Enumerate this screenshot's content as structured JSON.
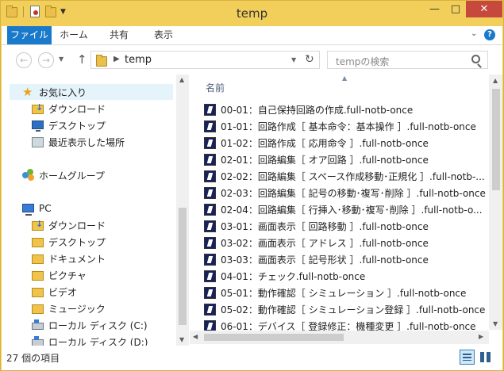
{
  "window": {
    "title": "temp"
  },
  "ribbon": {
    "tabs": [
      "ファイル",
      "ホーム",
      "共有",
      "表示"
    ],
    "help_symbol": "?"
  },
  "navigation": {
    "path": "temp",
    "search_placeholder": "tempの検索"
  },
  "sidebar": {
    "items": [
      {
        "label": "お気に入り",
        "icon": "star-icon",
        "indent": 0
      },
      {
        "label": "ダウンロード",
        "icon": "downloads-folder-icon",
        "indent": 1
      },
      {
        "label": "デスクトップ",
        "icon": "desktop-icon",
        "indent": 1
      },
      {
        "label": "最近表示した場所",
        "icon": "recent-places-icon",
        "indent": 1
      },
      {
        "label": "ホームグループ",
        "icon": "homegroup-icon",
        "indent": 0
      },
      {
        "label": "PC",
        "icon": "pc-icon",
        "indent": 0
      },
      {
        "label": "ダウンロード",
        "icon": "downloads-folder-icon",
        "indent": 1
      },
      {
        "label": "デスクトップ",
        "icon": "desktop-folder-icon",
        "indent": 1
      },
      {
        "label": "ドキュメント",
        "icon": "documents-folder-icon",
        "indent": 1
      },
      {
        "label": "ピクチャ",
        "icon": "pictures-folder-icon",
        "indent": 1
      },
      {
        "label": "ビデオ",
        "icon": "videos-folder-icon",
        "indent": 1
      },
      {
        "label": "ミュージック",
        "icon": "music-folder-icon",
        "indent": 1
      },
      {
        "label": "ローカル ディスク (C:)",
        "icon": "drive-icon",
        "indent": 1
      },
      {
        "label": "ローカル ディスク (D:)",
        "icon": "drive-icon",
        "indent": 1
      }
    ]
  },
  "filelist": {
    "column_name": "名前",
    "files": [
      "00-01：自己保持回路の作成.full-notb-once",
      "01-01：回路作成［ 基本命令：基本操作 ］.full-notb-once",
      "01-02：回路作成［ 応用命令 ］.full-notb-once",
      "02-01：回路編集［ オア回路 ］.full-notb-once",
      "02-02：回路編集［ スペース作成移動･正規化 ］.full-notb-...",
      "02-03：回路編集［ 記号の移動･複写･削除 ］.full-notb-once",
      "02-04：回路編集［ 行挿入･移動･複写･削除 ］.full-notb-o...",
      "03-01：画面表示［ 回路移動 ］.full-notb-once",
      "03-02：画面表示［ アドレス ］.full-notb-once",
      "03-03：画面表示［ 記号形状 ］.full-notb-once",
      "04-01：チェック.full-notb-once",
      "05-01：動作確認［ シミュレーション ］.full-notb-once",
      "05-02：動作確認［ シミュレーション登録 ］.full-notb-once",
      "06-01：デバイス［ 登録修正：機種変更 ］.full-notb-once"
    ]
  },
  "status": {
    "item_count": "27 個の項目"
  }
}
